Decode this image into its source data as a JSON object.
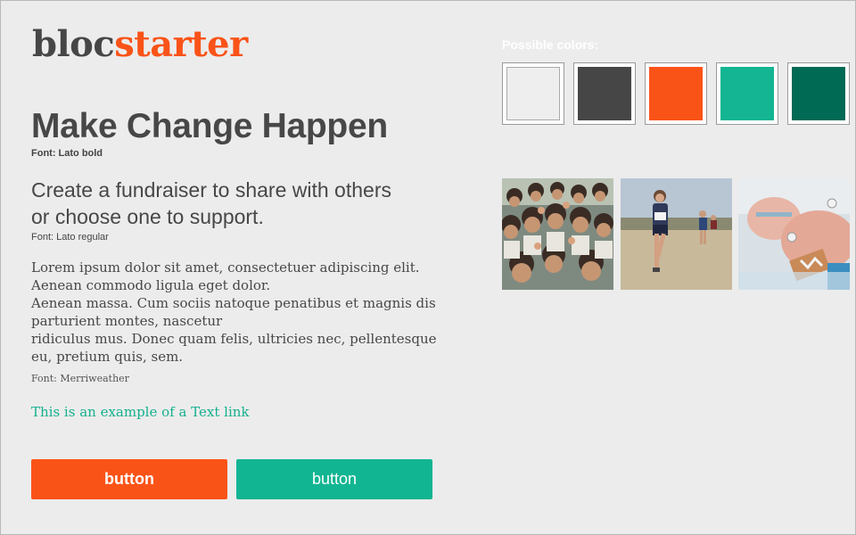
{
  "logo": {
    "part1": "bloc",
    "part2": "starter"
  },
  "headline": {
    "text": "Make Change Happen",
    "note": "Font: Lato bold"
  },
  "subheading": {
    "line1": "Create a fundraiser to share with others",
    "line2": "or choose one to support.",
    "note": "Font: Lato regular"
  },
  "body": {
    "lines": [
      "Lorem ipsum dolor sit amet, consectetuer adipiscing elit.",
      "Aenean commodo ligula eget dolor.",
      "Aenean massa. Cum sociis natoque penatibus et magnis dis",
      "parturient montes, nascetur",
      "ridiculus mus. Donec quam felis, ultricies nec, pellentesque",
      "eu, pretium quis, sem."
    ],
    "note": "Font: Merriweather"
  },
  "link": {
    "text": "This is an example of a Text link"
  },
  "buttons": {
    "primary": "button",
    "secondary": "button"
  },
  "palette": {
    "label": "Possible colors:",
    "colors": [
      "#eeeeee",
      "#464646",
      "#fa5318",
      "#13b592",
      "#006a55"
    ]
  },
  "photos": [
    {
      "icon": "children-waving-photo"
    },
    {
      "icon": "runner-photo"
    },
    {
      "icon": "newborn-baby-photo"
    }
  ]
}
